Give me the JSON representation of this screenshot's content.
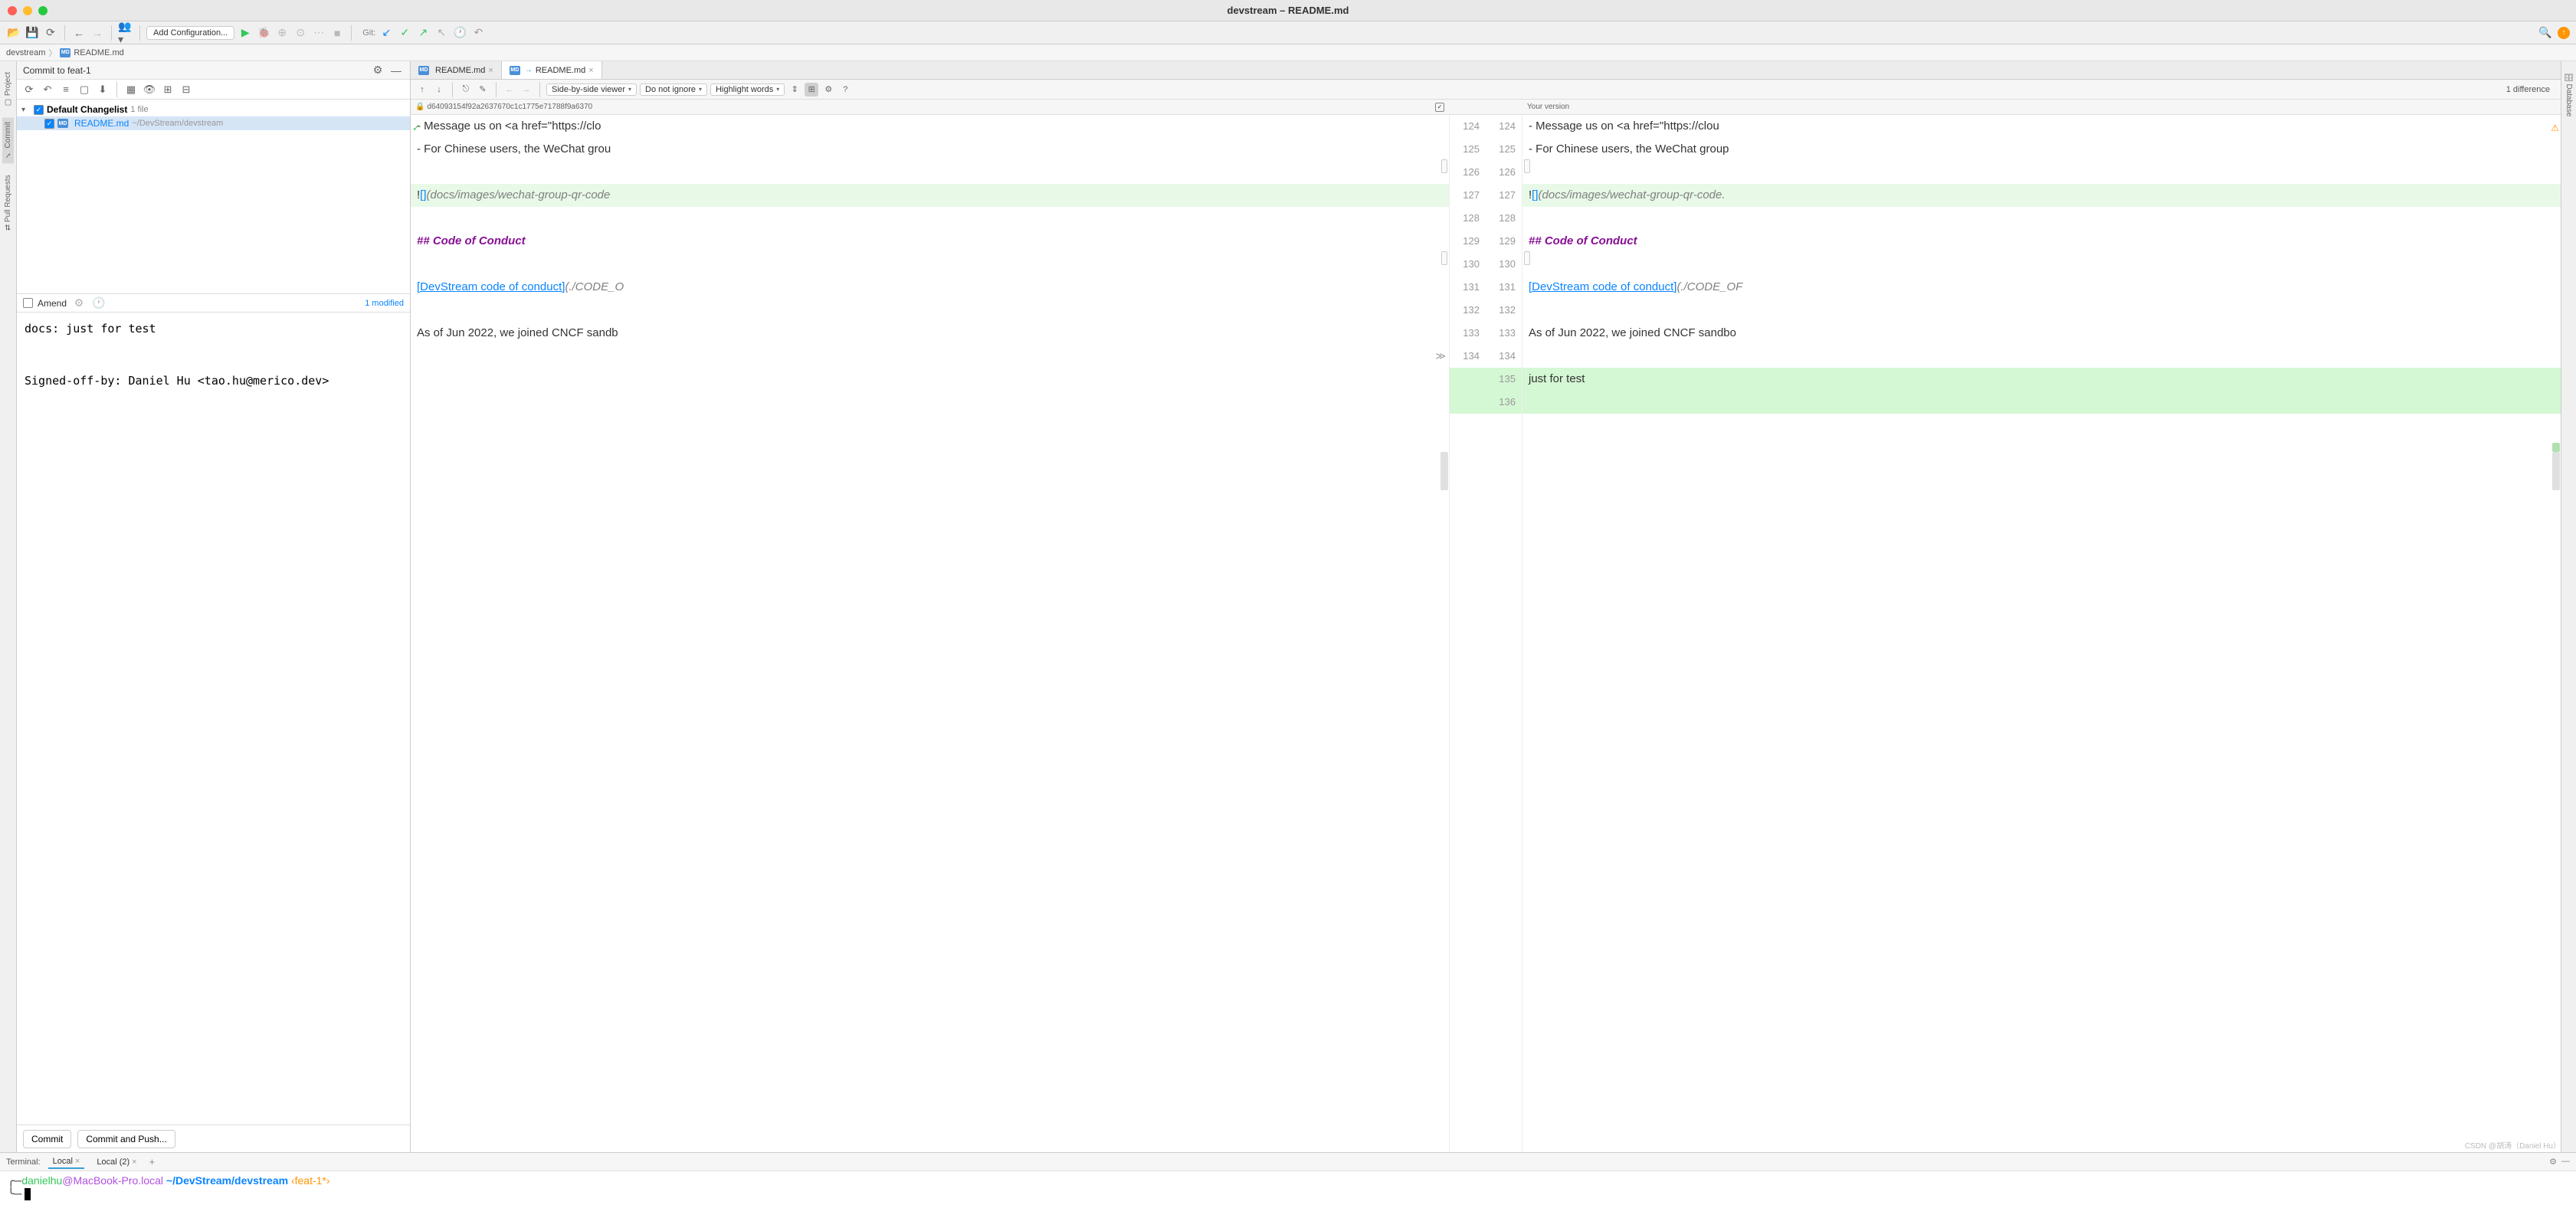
{
  "window": {
    "title": "devstream – README.md"
  },
  "toolbar": {
    "config": "Add Configuration...",
    "git_label": "Git:"
  },
  "breadcrumb": {
    "project": "devstream",
    "file": "README.md"
  },
  "left_rail": {
    "project": "Project",
    "commit": "Commit",
    "pull_requests": "Pull Requests"
  },
  "right_rail": {
    "database": "Database"
  },
  "commit_panel": {
    "header": "Commit to feat-1",
    "changelist_label": "Default Changelist",
    "changelist_count": "1 file",
    "file_name": "README.md",
    "file_path": "~/DevStream/devstream",
    "amend": "Amend",
    "modified": "1 modified",
    "message": "docs: just for test\n\n\nSigned-off-by: Daniel Hu <tao.hu@merico.dev>",
    "commit_btn": "Commit",
    "commit_push_btn": "Commit and Push..."
  },
  "editor_tabs": {
    "tab1": "README.md",
    "tab2": "README.md"
  },
  "diff_toolbar": {
    "viewer": "Side-by-side viewer",
    "ignore": "Do not ignore",
    "highlight": "Highlight words",
    "count": "1 difference"
  },
  "diff_filebar": {
    "left_rev": "d64093154f92a2637670c1c1775e71788f9a6370",
    "right_label": "Your version"
  },
  "diff_lines": {
    "left_nums": [
      "124",
      "125",
      "126",
      "127",
      "128",
      "129",
      "130",
      "131",
      "132",
      "133",
      "134",
      "",
      ""
    ],
    "right_nums": [
      "124",
      "125",
      "126",
      "127",
      "128",
      "129",
      "130",
      "131",
      "132",
      "133",
      "134",
      "135",
      "136"
    ],
    "l124": "- Message us on <a href=\"https://clo",
    "l125": "- For Chinese users, the WeChat grou",
    "l127_pre": "!",
    "l127_br": "[]",
    "l127_path": "(docs/images/wechat-group-qr-code",
    "l129": "## Code of Conduct",
    "l131_link": "[DevStream code of conduct]",
    "l131_path": "(./CODE_O",
    "l133": "As of Jun 2022, we joined CNCF sandb",
    "r124": "- Message us on <a href=\"https://clou",
    "r125": "- For Chinese users, the WeChat group",
    "r127_path": "(docs/images/wechat-group-qr-code.",
    "r131_path": "(./CODE_OF",
    "r133": "As of Jun 2022, we joined CNCF sandbo",
    "r135": "just for test"
  },
  "terminal": {
    "label": "Terminal:",
    "tab1": "Local",
    "tab2": "Local (2)",
    "user": "danielhu",
    "at": "@",
    "host": "MacBook-Pro.local",
    "path": "~/DevStream/devstream",
    "branch": "‹feat-1*›",
    "prompt2": "╰─"
  },
  "watermark": "CSDN @胡涛（Daniel Hu）"
}
